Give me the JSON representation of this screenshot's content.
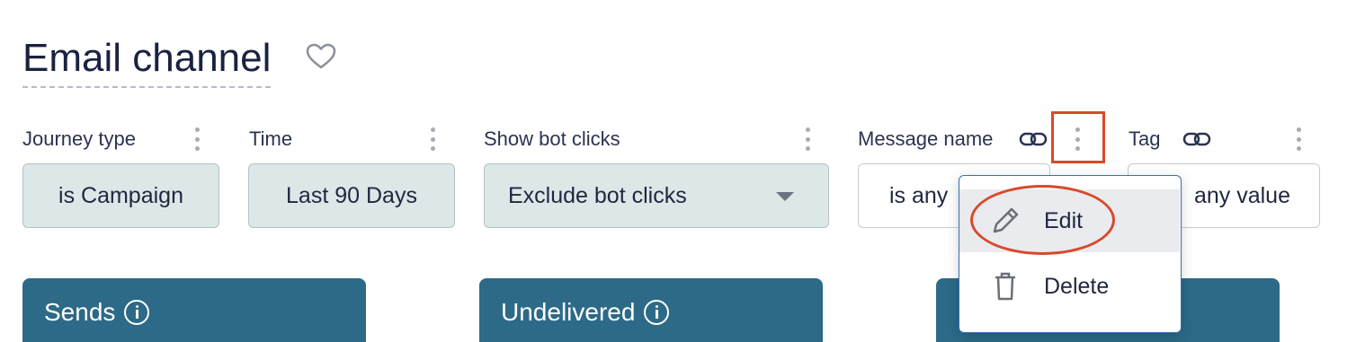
{
  "header": {
    "title": "Email channel"
  },
  "filters": [
    {
      "label": "Journey type",
      "value": "is Campaign"
    },
    {
      "label": "Time",
      "value": "Last 90 Days"
    },
    {
      "label": "Show bot clicks",
      "value": "Exclude bot clicks"
    },
    {
      "label": "Message name",
      "value": "is any"
    },
    {
      "label": "Tag",
      "value": "any value"
    }
  ],
  "menu": {
    "edit_label": "Edit",
    "delete_label": "Delete"
  },
  "cards": [
    {
      "title": "Sends"
    },
    {
      "title": "Undelivered"
    }
  ],
  "colors": {
    "accent": "#2c6a87",
    "pill_bg": "#dce7e7",
    "highlight": "#d9492b",
    "menu_border": "#3a6fb5"
  },
  "icons": [
    "heart-icon",
    "kebab-icon",
    "link-icon",
    "pencil-icon",
    "trash-icon",
    "info-icon",
    "caret-down-icon"
  ]
}
